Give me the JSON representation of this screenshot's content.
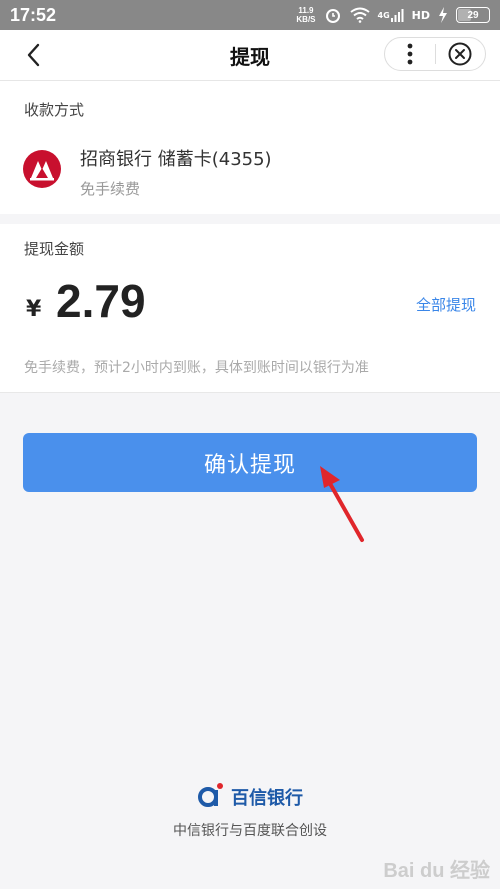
{
  "status_bar": {
    "time": "17:52",
    "net_speed_value": "11.9",
    "net_speed_unit": "KB/S",
    "signal_label": "4G",
    "hd_label": "HD",
    "battery": "29"
  },
  "nav": {
    "title": "提现"
  },
  "payment": {
    "label": "收款方式",
    "bank_name": "招商银行 储蓄卡(4355)",
    "fee": "免手续费"
  },
  "withdraw": {
    "label": "提现金额",
    "currency": "¥",
    "amount": "2.79",
    "all_link": "全部提现",
    "note": "免手续费，预计2小时内到账，具体到账时间以银行为准"
  },
  "confirm_label": "确认提现",
  "footer": {
    "brand": "百信银行",
    "tagline": "中信银行与百度联合创设"
  },
  "watermark": "Bai du 经验",
  "colors": {
    "accent": "#4a90ec",
    "link": "#3a86e8",
    "bank_red": "#c8102e",
    "arrow_red": "#e0262b"
  }
}
